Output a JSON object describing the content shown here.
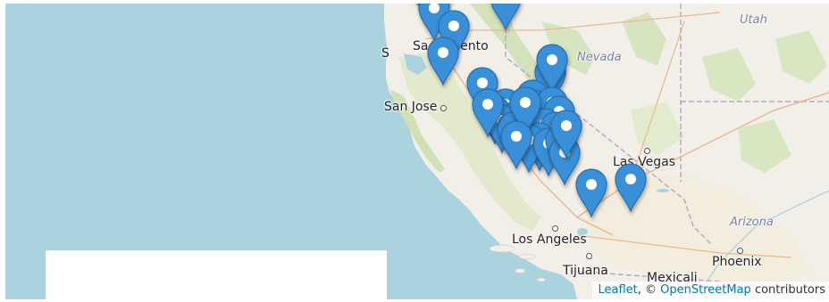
{
  "map": {
    "labels": {
      "sacramento": "Sacramento",
      "san_jose": "San Jose",
      "san_left": "S",
      "nevada": "Nevada",
      "utah": "Utah",
      "las_vegas": "Las Vegas",
      "arizona": "Arizona",
      "los_angeles": "Los Angeles",
      "phoenix": "Phoenix",
      "tijuana": "Tijuana",
      "mexicali": "Mexicali"
    },
    "marker_color": "#3a8fd9",
    "marker_count": 32
  },
  "attribution": {
    "leaflet": "Leaflet",
    "separator": ", © ",
    "osm": "OpenStreetMap",
    "suffix": " contributors"
  }
}
